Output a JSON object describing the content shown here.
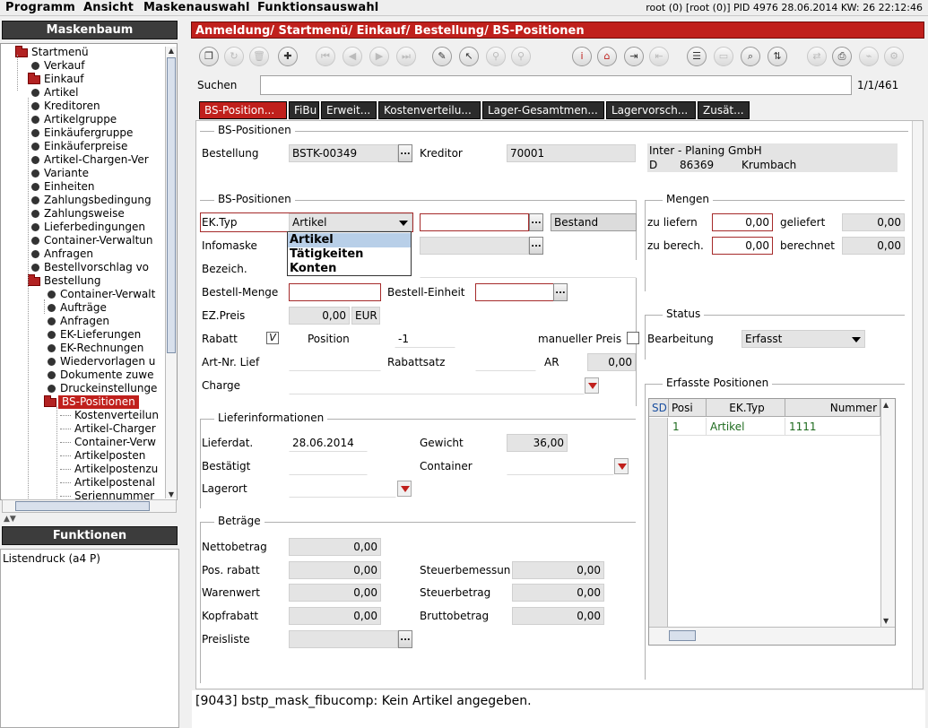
{
  "menu": {
    "items": [
      "Programm",
      "Ansicht",
      "Maskenauswahl",
      "Funktionsauswahl"
    ],
    "sysinfo": "root (0) [root (0)] PID 4976  28.06.2014 KW: 26  22:12:46"
  },
  "sidebar": {
    "title": "Maskenbaum",
    "tree": [
      {
        "label": "Startmenü",
        "level": 0,
        "type": "folder"
      },
      {
        "label": "Verkauf",
        "level": 1,
        "type": "leaf"
      },
      {
        "label": "Einkauf",
        "level": 1,
        "type": "folder"
      },
      {
        "label": "Artikel",
        "level": 2,
        "type": "leaf"
      },
      {
        "label": "Kreditoren",
        "level": 2,
        "type": "leaf"
      },
      {
        "label": "Artikelgruppe",
        "level": 2,
        "type": "leaf"
      },
      {
        "label": "Einkäufergruppe",
        "level": 2,
        "type": "leaf"
      },
      {
        "label": "Einkäuferpreise",
        "level": 2,
        "type": "leaf"
      },
      {
        "label": "Artikel-Chargen-Ver",
        "level": 2,
        "type": "leaf"
      },
      {
        "label": "Variante",
        "level": 2,
        "type": "leaf"
      },
      {
        "label": "Einheiten",
        "level": 2,
        "type": "leaf"
      },
      {
        "label": "Zahlungsbedingung",
        "level": 2,
        "type": "leaf"
      },
      {
        "label": "Zahlungsweise",
        "level": 2,
        "type": "leaf"
      },
      {
        "label": "Lieferbedingungen",
        "level": 2,
        "type": "leaf"
      },
      {
        "label": "Container-Verwaltun",
        "level": 2,
        "type": "leaf"
      },
      {
        "label": "Anfragen",
        "level": 2,
        "type": "leaf"
      },
      {
        "label": "Bestellvorschlag vo",
        "level": 2,
        "type": "leaf"
      },
      {
        "label": "Bestellung",
        "level": 2,
        "type": "folder"
      },
      {
        "label": "Container-Verwalt",
        "level": 3,
        "type": "leaf"
      },
      {
        "label": "Aufträge",
        "level": 3,
        "type": "leaf"
      },
      {
        "label": "Anfragen",
        "level": 3,
        "type": "leaf"
      },
      {
        "label": "EK-Lieferungen",
        "level": 3,
        "type": "leaf"
      },
      {
        "label": "EK-Rechnungen",
        "level": 3,
        "type": "leaf"
      },
      {
        "label": "Wiedervorlagen u",
        "level": 3,
        "type": "leaf"
      },
      {
        "label": "Dokumente zuwe",
        "level": 3,
        "type": "leaf"
      },
      {
        "label": "Druckeinstellunge",
        "level": 3,
        "type": "leaf"
      },
      {
        "label": "BS-Positionen",
        "level": 3,
        "type": "folder",
        "selected": true
      },
      {
        "label": "Kostenverteilun",
        "level": 4,
        "type": "line"
      },
      {
        "label": "Artikel-Charger",
        "level": 4,
        "type": "line"
      },
      {
        "label": "Container-Verw",
        "level": 4,
        "type": "line"
      },
      {
        "label": "Artikelposten",
        "level": 4,
        "type": "line"
      },
      {
        "label": "Artikelpostenzu",
        "level": 4,
        "type": "line"
      },
      {
        "label": "Artikelpostenal",
        "level": 4,
        "type": "line"
      },
      {
        "label": "Seriennummer",
        "level": 4,
        "type": "line"
      }
    ]
  },
  "functions": {
    "title": "Funktionen",
    "items": [
      "Listendruck (a4 P)"
    ]
  },
  "window": {
    "title": "Anmeldung/ Startmenü/ Einkauf/ Bestellung/ BS-Positionen"
  },
  "toolbar": {
    "buttons": [
      "window-icon",
      "refresh-icon",
      "trash-icon",
      "plus-icon",
      "first-icon",
      "prev-icon",
      "next-icon",
      "last-icon",
      "pencil-icon",
      "pointer-icon",
      "link-search-icon",
      "link-icon",
      "info-icon",
      "home-icon",
      "exit-icon",
      "import-icon",
      "notes-icon",
      "print-icon",
      "search-icon",
      "sort-icon",
      "swap-icon",
      "export-icon",
      "attach-icon",
      "config-icon"
    ]
  },
  "search": {
    "label": "Suchen",
    "value": "",
    "counter": "1/1/461"
  },
  "tabs": [
    "BS-Position...",
    "FiBu",
    "Erweit...",
    "Kostenverteilu...",
    "Lager-Gesamtmen...",
    "Lagervorsch...",
    "Zusät..."
  ],
  "form": {
    "sec1": {
      "title": "BS-Positionen",
      "bestellung_label": "Bestellung",
      "bestellung_value": "BSTK-00349",
      "kreditor_label": "Kreditor",
      "kreditor_value": "70001",
      "address_line1": "Inter - Planing GmbH",
      "address_country": "D",
      "address_zip": "86369",
      "address_city": "Krumbach"
    },
    "sec2": {
      "title": "BS-Positionen",
      "ektyp_label": "EK.Typ",
      "ektyp_value": "Artikel",
      "bestand_label": "Bestand",
      "infomaske_label": "Infomaske",
      "bezeich_label": "Bezeich.",
      "menge_label": "Bestell-Menge",
      "einheit_label": "Bestell-Einheit",
      "ezpreis_label": "EZ.Preis",
      "ezpreis_value": "0,00",
      "currency": "EUR",
      "rabatt_label": "Rabatt",
      "rabatt_check": "V",
      "position_label": "Position",
      "position_value": "-1",
      "manpreis_label": "manueller Preis",
      "artnr_label": "Art-Nr. Lief",
      "rabattsatz_label": "Rabattsatz",
      "ar_label": "AR",
      "ar_value": "0,00",
      "charge_label": "Charge"
    },
    "mengen": {
      "title": "Mengen",
      "zuliefern_label": "zu liefern",
      "zuliefern_value": "0,00",
      "geliefert_label": "geliefert",
      "geliefert_value": "0,00",
      "zuberech_label": "zu berech.",
      "zuberech_value": "0,00",
      "berechnet_label": "berechnet",
      "berechnet_value": "0,00"
    },
    "status": {
      "title": "Status",
      "bearbeitung_label": "Bearbeitung",
      "bearbeitung_value": "Erfasst"
    },
    "erfasste": {
      "title": "Erfasste Positionen",
      "columns": [
        "SD",
        "Posi",
        "EK.Typ",
        "Nummer"
      ],
      "rows": [
        [
          "",
          "1",
          "Artikel",
          "1111"
        ]
      ]
    },
    "liefer": {
      "title": "Lieferinformationen",
      "lieferdat_label": "Lieferdat.",
      "lieferdat_value": "28.06.2014",
      "gewicht_label": "Gewicht",
      "gewicht_value": "36,00",
      "bestaetigt_label": "Bestätigt",
      "container_label": "Container",
      "lagerort_label": "Lagerort"
    },
    "betraege": {
      "title": "Beträge",
      "netto_label": "Nettobetrag",
      "netto_value": "0,00",
      "posrabatt_label": "Pos. rabatt",
      "posrabatt_value": "0,00",
      "steuerbem_label": "Steuerbemessun",
      "steuerbem_value": "0,00",
      "warenwert_label": "Warenwert",
      "warenwert_value": "0,00",
      "steuerbetrag_label": "Steuerbetrag",
      "steuerbetrag_value": "0,00",
      "kopfrabatt_label": "Kopfrabatt",
      "kopfrabatt_value": "0,00",
      "brutto_label": "Bruttobetrag",
      "brutto_value": "0,00",
      "preisliste_label": "Preisliste"
    }
  },
  "popup": {
    "options": [
      "Artikel",
      "Tätigkeiten",
      "Konten"
    ]
  },
  "statusbar": {
    "message": "[9043] bstp_mask_fibucomp: Kein Artikel angegeben."
  },
  "colors": {
    "accent": "#c0201c",
    "dark": "#3c3c3c",
    "selection": "#b8cfe8"
  }
}
